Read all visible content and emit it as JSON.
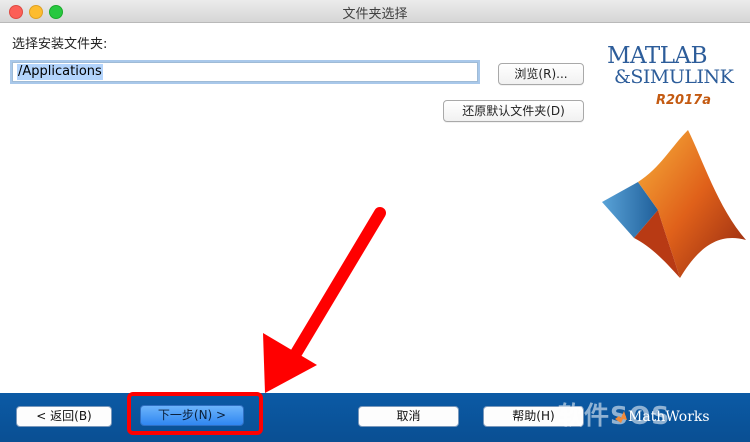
{
  "window": {
    "title": "文件夹选择"
  },
  "form": {
    "choose_label": "选择安装文件夹:",
    "path_value": "/Applications",
    "browse_label": "浏览(R)...",
    "restore_label": "还原默认文件夹(D)"
  },
  "logo": {
    "line1": "MATLAB",
    "line2": "&SIMULINK",
    "release": "R2017a"
  },
  "bottom": {
    "back_label": "< 返回(B)",
    "next_label": "下一步(N) >",
    "cancel_label": "取消",
    "help_label": "帮助(H)",
    "brand": "MathWorks",
    "watermark": "软件SOS"
  },
  "colors": {
    "accent": "#0a4f93",
    "highlight": "#ff0000",
    "logo_blue": "#2d5d9a",
    "release_orange": "#c45a11"
  }
}
